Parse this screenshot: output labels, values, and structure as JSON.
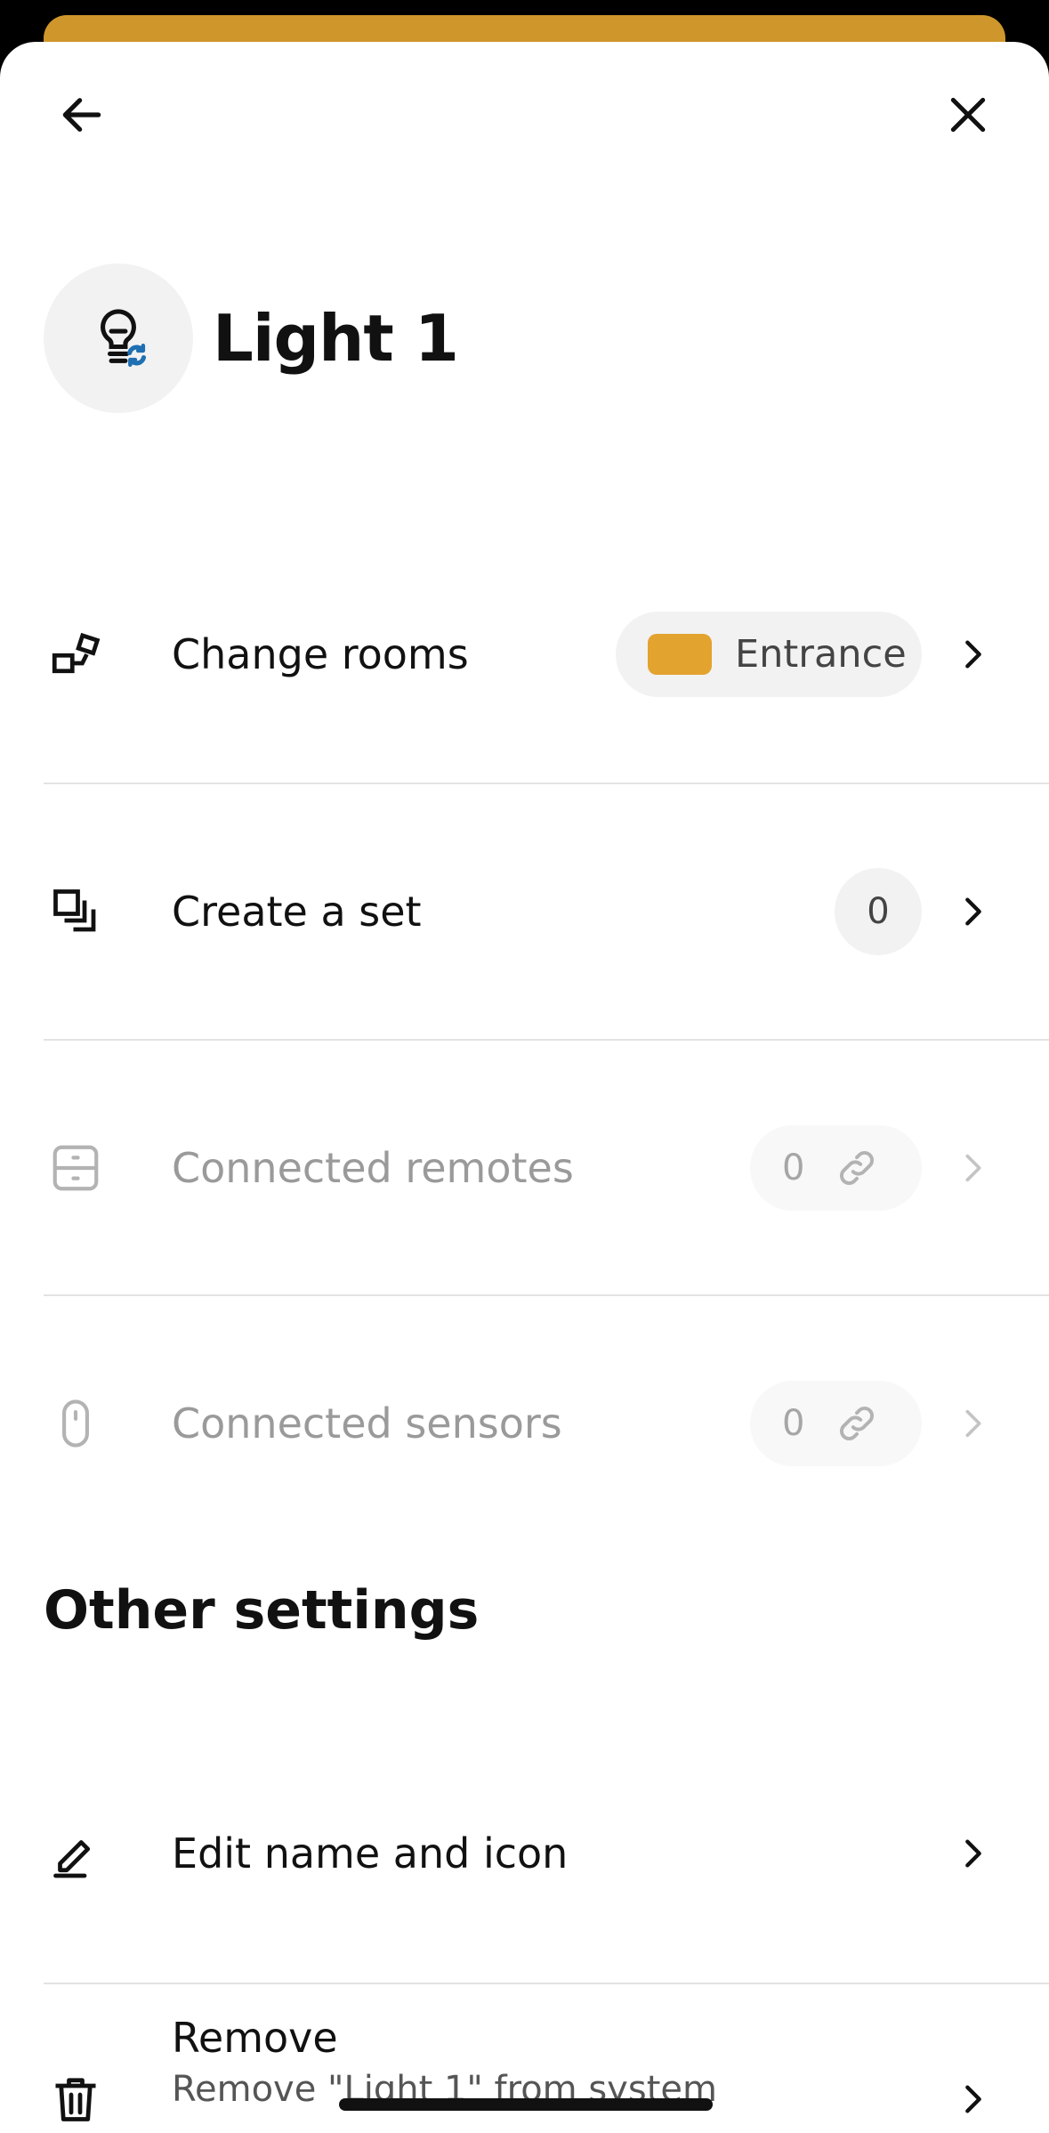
{
  "device": {
    "name": "Light 1",
    "icon": "bulb-sync-icon"
  },
  "colors": {
    "accent": "#cf962b",
    "room_color": "#e3a32f",
    "sync_badge": "#1f6fb3"
  },
  "rows": {
    "change_rooms": {
      "label": "Change rooms",
      "room": "Entrance",
      "icon": "rooms-icon"
    },
    "create_set": {
      "label": "Create a set",
      "count": "0",
      "icon": "set-icon"
    },
    "connected_remotes": {
      "label": "Connected remotes",
      "count": "0",
      "icon": "remote-icon",
      "disabled": true
    },
    "connected_sensors": {
      "label": "Connected sensors",
      "count": "0",
      "icon": "sensor-icon",
      "disabled": true
    }
  },
  "other_settings": {
    "title": "Other settings",
    "edit": {
      "label": "Edit name and icon",
      "icon": "pencil-icon"
    },
    "remove": {
      "label": "Remove",
      "sublabel": "Remove \"Light 1\" from system",
      "icon": "trash-icon"
    }
  }
}
